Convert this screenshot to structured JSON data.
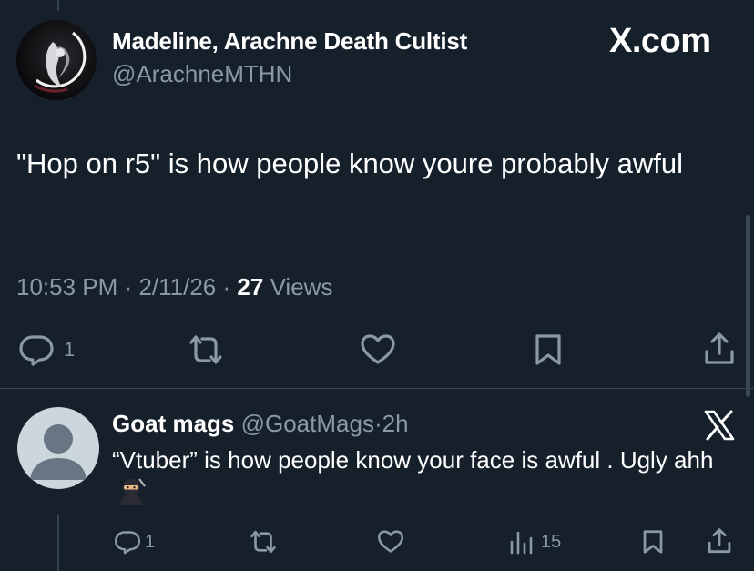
{
  "main_tweet": {
    "author_name": "Madeline, Arachne Death Cultist",
    "handle": "@ArachneMTHN",
    "text": "\"Hop on r5\" is how people know youre probably awful",
    "time": "10:53 PM",
    "date": "2/11/26",
    "separator": "·",
    "views_count": "27",
    "views_label": "Views",
    "replies_count": "1"
  },
  "watermark": "X.com",
  "reply": {
    "author_name": "Goat mags",
    "handle": "@GoatMags",
    "separator": "·",
    "age": "2h",
    "text": "“Vtuber” is how people know your face is awful . Ugly ahh",
    "emoji": "ninja",
    "replies_count": "1",
    "views_count": "15"
  },
  "colors": {
    "background": "#15202b",
    "secondary_text": "#8b98a5",
    "divider": "#38444d"
  },
  "icons": [
    "reply-icon",
    "retweet-icon",
    "like-icon",
    "bookmark-icon",
    "share-icon",
    "analytics-icon",
    "x-logo-icon",
    "ninja-emoji-icon"
  ]
}
